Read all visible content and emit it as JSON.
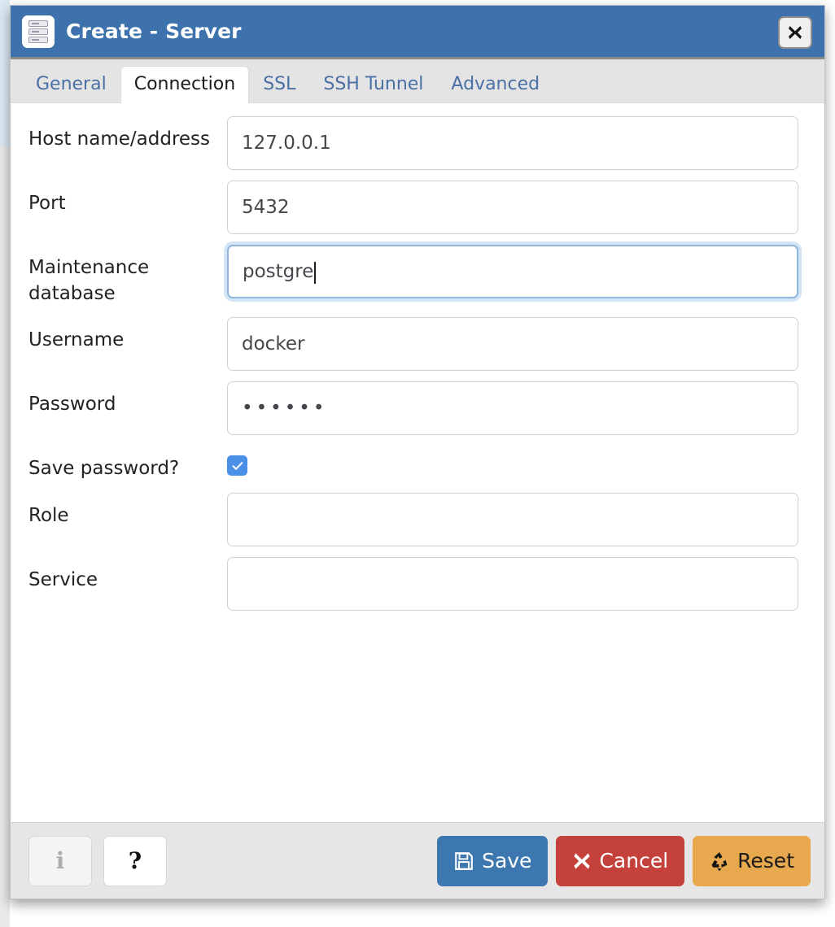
{
  "window": {
    "title": "Create - Server",
    "icon": "server-icon",
    "close_label": "✖",
    "header_color": "#3d72ac"
  },
  "tabs": [
    {
      "label": "General",
      "active": false
    },
    {
      "label": "Connection",
      "active": true
    },
    {
      "label": "SSL",
      "active": false
    },
    {
      "label": "SSH Tunnel",
      "active": false
    },
    {
      "label": "Advanced",
      "active": false
    }
  ],
  "form": {
    "host": {
      "label": "Host name/address",
      "value": "127.0.0.1",
      "focused": false
    },
    "port": {
      "label": "Port",
      "value": "5432",
      "focused": false
    },
    "maintenance_db": {
      "label": "Maintenance database",
      "value": "postgre",
      "focused": true
    },
    "username": {
      "label": "Username",
      "value": "docker",
      "focused": false
    },
    "password": {
      "label": "Password",
      "value": "••••••",
      "focused": false
    },
    "save_password": {
      "label": "Save password?",
      "checked": true,
      "color": "#4a90e8"
    },
    "role": {
      "label": "Role",
      "value": "",
      "focused": false
    },
    "service": {
      "label": "Service",
      "value": "",
      "focused": false
    }
  },
  "footer": {
    "info_label": "i",
    "help_label": "?",
    "save_label": "Save",
    "cancel_label": "Cancel",
    "reset_label": "Reset",
    "save_color": "#3d77b0",
    "cancel_color": "#c5423c",
    "reset_color": "#e8a84d"
  }
}
